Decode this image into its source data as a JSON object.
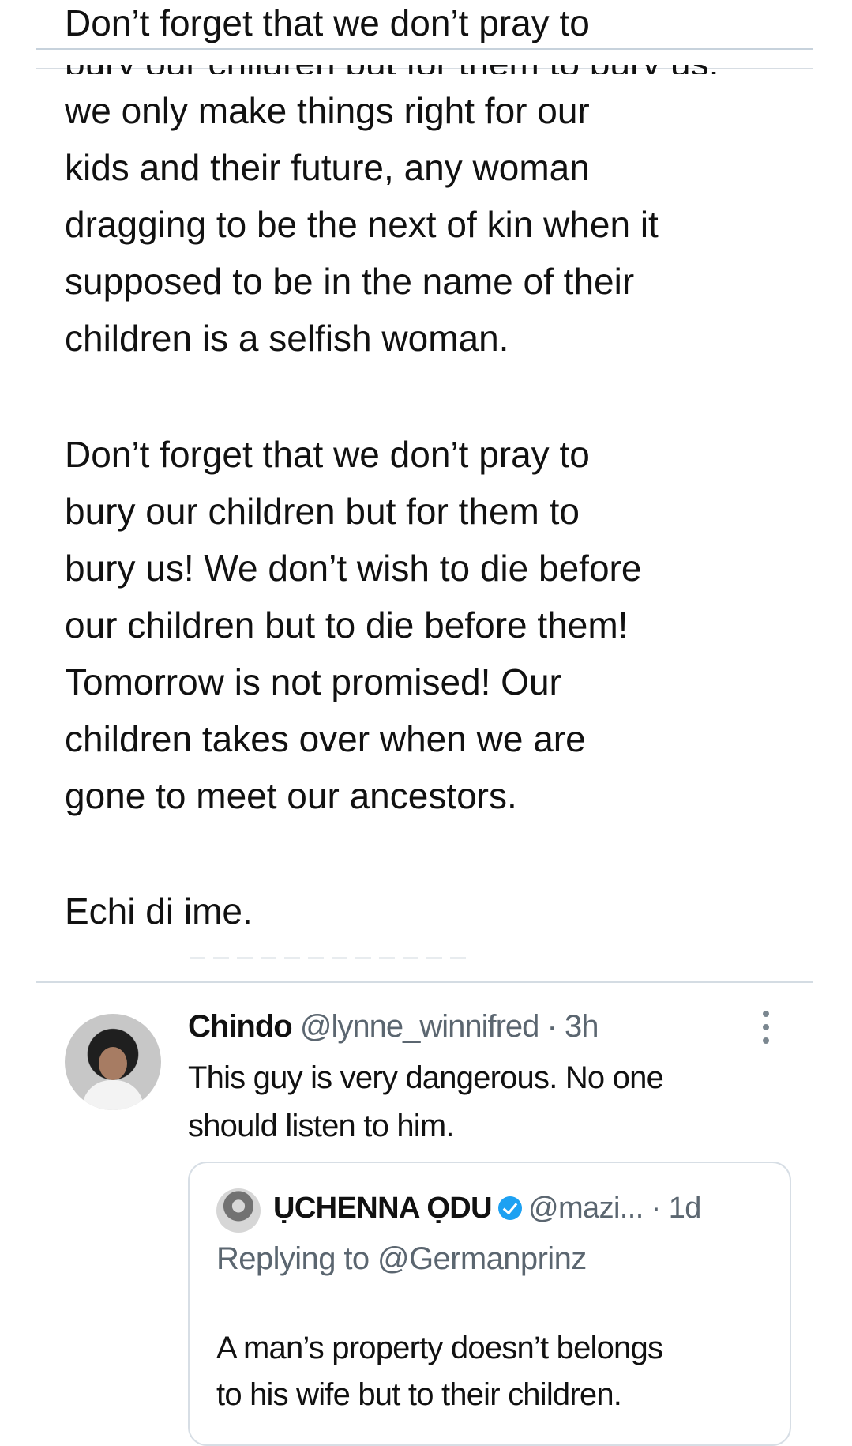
{
  "tweet": {
    "top_line": "Don’t forget that we don’t pray to",
    "cut_line": "bury our children but for them to bury us,",
    "paragraph_1": "we only make things right for our\nkids and their future, any woman\ndragging to be the next of kin when it\nsupposed to be in the name of their\nchildren is a selfish woman.",
    "paragraph_2": "Don’t forget that we don’t pray to\nbury our children but for them to\nbury us! We don’t wish to die before\nour children but to die before them!\nTomorrow is not promised! Our\nchildren takes over when we are\ngone to meet our ancestors.",
    "paragraph_3": "Echi di ime."
  },
  "reply": {
    "name": "Chindo",
    "handle": "@lynne_winnifred",
    "separator": "·",
    "time": "3h",
    "text": "This guy is very dangerous. No one\nshould listen to him.",
    "more_icon": "more-vertical-icon"
  },
  "quoted_tweet": {
    "name": "ỤCHENNA ỌDU",
    "handle": "@mazi...",
    "separator": "·",
    "time": "1d",
    "replying_to": "Replying to @Germanprinz",
    "text": "A man’s property doesn’t belongs\nto his wife but to their children.",
    "verified_icon": "verified-badge-icon"
  },
  "colors": {
    "text": "#111111",
    "muted": "#5b6670",
    "divider": "#d4dce3",
    "verified": "#1da1f2"
  }
}
